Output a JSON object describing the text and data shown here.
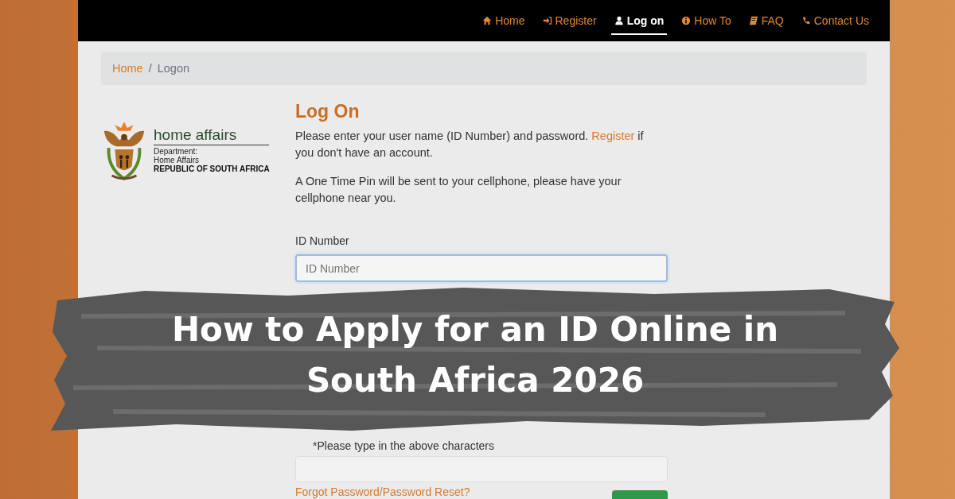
{
  "nav": {
    "items": [
      {
        "label": "Home",
        "selected": false
      },
      {
        "label": "Register",
        "selected": false
      },
      {
        "label": "Log on",
        "selected": true
      },
      {
        "label": "How To",
        "selected": false
      },
      {
        "label": "FAQ",
        "selected": false
      },
      {
        "label": "Contact Us",
        "selected": false
      }
    ]
  },
  "breadcrumb": {
    "separator": "/",
    "items": [
      {
        "label": "Home",
        "current": false
      },
      {
        "label": "Logon",
        "current": true
      }
    ]
  },
  "department": {
    "name": "home affairs",
    "lines": [
      "Department:",
      "Home Affairs"
    ],
    "country": "REPUBLIC OF SOUTH AFRICA"
  },
  "form": {
    "title": "Log On",
    "intro_before": "Please enter your user name (ID Number) and password.",
    "intro_link": "Register",
    "intro_after": "if you don't have an account.",
    "otp_note": "A One Time Pin will be sent to your cellphone, please have your cellphone near you.",
    "id_label": "ID Number",
    "id_field": {
      "placeholder": "ID Number",
      "focused": true
    },
    "captcha_label": "*Please type in the above characters",
    "forgot_link": "Forgot Password/Password Reset?"
  },
  "banner": {
    "title": "How to Apply for an ID Online in South Africa 2026"
  }
}
